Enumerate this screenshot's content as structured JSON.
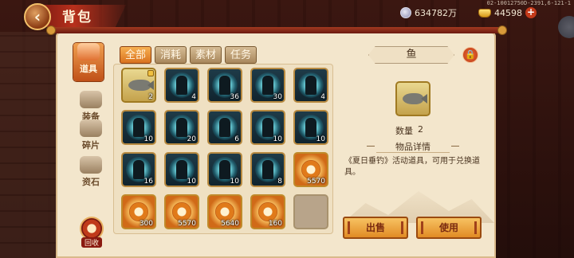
{
  "header": {
    "title": "背包",
    "back_icon": "back-arrow-icon"
  },
  "currency": {
    "silver": "634782万",
    "gold": "44598",
    "debug_id": "02-10012750D-2391,6-121-1"
  },
  "left_nav": {
    "items": [
      {
        "label": "道具",
        "icon": "bag-icon",
        "active": true
      },
      {
        "label": "装备",
        "icon": "armor-icon",
        "active": false
      },
      {
        "label": "碎片",
        "icon": "puzzle-icon",
        "active": false
      },
      {
        "label": "资石",
        "icon": "stone-icon",
        "active": false
      }
    ],
    "recycle_label": "回收"
  },
  "tabs": [
    {
      "label": "全部",
      "active": true
    },
    {
      "label": "消耗",
      "active": false
    },
    {
      "label": "素材",
      "active": false
    },
    {
      "label": "任务",
      "active": false
    }
  ],
  "grid": {
    "items": [
      {
        "kind": "fish",
        "count": "2",
        "locked": true
      },
      {
        "kind": "hero",
        "count": "4"
      },
      {
        "kind": "hero",
        "count": "36"
      },
      {
        "kind": "hero",
        "count": "30"
      },
      {
        "kind": "hero",
        "count": "4"
      },
      {
        "kind": "hero",
        "count": "10"
      },
      {
        "kind": "hero",
        "count": "20"
      },
      {
        "kind": "hero",
        "count": "6"
      },
      {
        "kind": "hero",
        "count": "10"
      },
      {
        "kind": "hero",
        "count": "10"
      },
      {
        "kind": "hero",
        "count": "16"
      },
      {
        "kind": "hero",
        "count": "10"
      },
      {
        "kind": "hero",
        "count": "10"
      },
      {
        "kind": "hero",
        "count": "8"
      },
      {
        "kind": "orange",
        "count": "5570"
      },
      {
        "kind": "orange",
        "count": "300"
      },
      {
        "kind": "orange",
        "count": "5570"
      },
      {
        "kind": "orange",
        "count": "5640"
      },
      {
        "kind": "orange",
        "count": "160"
      },
      {
        "kind": "empty",
        "count": ""
      }
    ]
  },
  "detail": {
    "name": "鱼",
    "lock_icon": "lock-icon",
    "quantity_label": "数量",
    "quantity_value": "2",
    "section_title": "物品详情",
    "description": "《夏日垂钓》活动道具，可用于兑换道具。",
    "sell_label": "出售",
    "use_label": "使用"
  }
}
